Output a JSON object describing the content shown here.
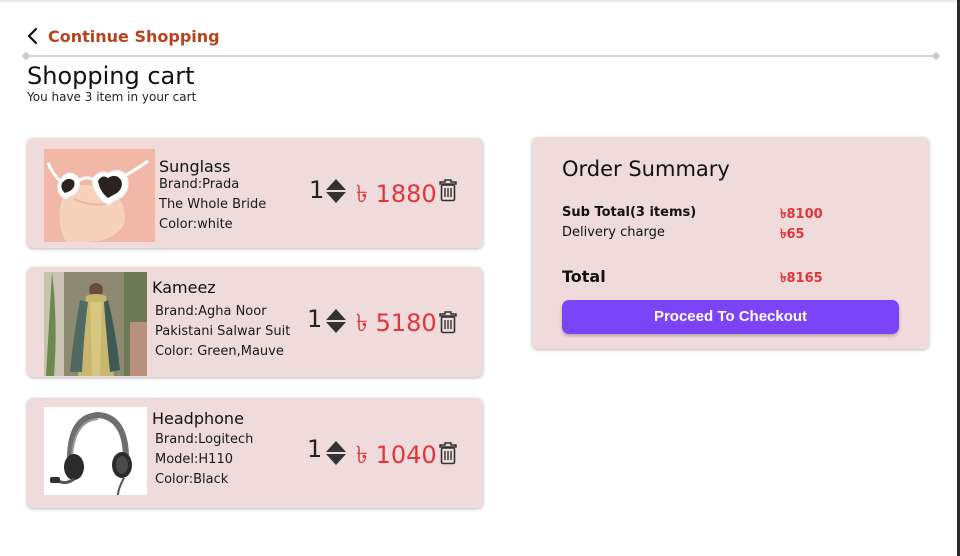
{
  "nav": {
    "back_label": "Continue Shopping"
  },
  "page": {
    "title": "Shopping cart",
    "subtitle": "You have 3 item in your cart"
  },
  "cart": {
    "items": [
      {
        "name": "Sunglass",
        "lines": [
          "Brand:Prada",
          "The Whole Bride",
          "Color:white"
        ],
        "qty": "1",
        "price": "৳ 1880"
      },
      {
        "name": "Kameez",
        "lines": [
          "Brand:Agha Noor",
          "Pakistani Salwar Suit",
          "Color: Green,Mauve"
        ],
        "qty": "1",
        "price": "৳ 5180"
      },
      {
        "name": "Headphone",
        "lines": [
          "Brand:Logitech",
          "Model:H110",
          "Color:Black"
        ],
        "qty": "1",
        "price": "৳ 1040"
      }
    ]
  },
  "summary": {
    "title": "Order Summary",
    "subtotal_label": "Sub Total(3 items)",
    "subtotal_value": "৳8100",
    "delivery_label": "Delivery charge",
    "delivery_value": "৳65",
    "total_label": "Total",
    "total_value": "৳8165",
    "checkout_label": "Proceed To Checkout"
  },
  "colors": {
    "accent": "#7b45f7",
    "price": "#e0353a",
    "card_bg": "#efdbdb",
    "link": "#b8431c"
  }
}
